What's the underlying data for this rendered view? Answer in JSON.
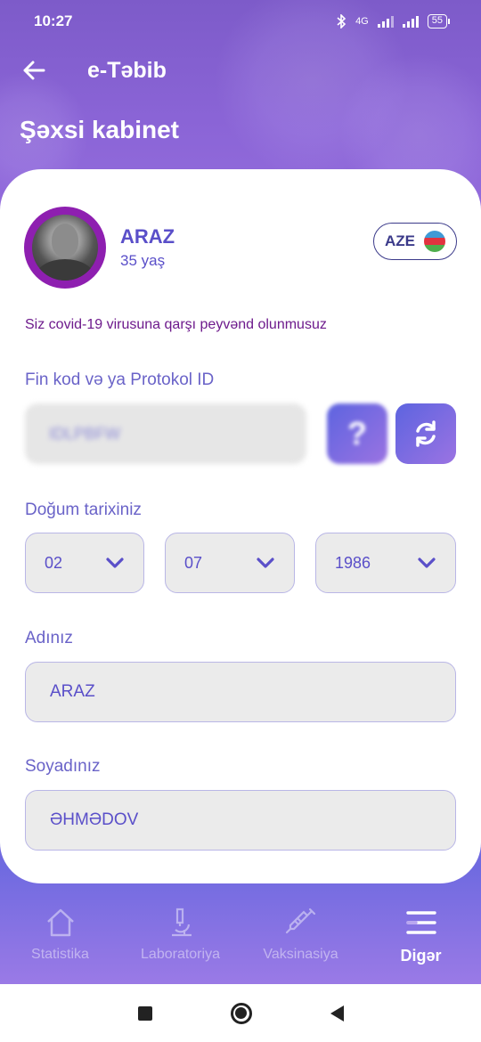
{
  "status_bar": {
    "time": "10:27",
    "network": "4G",
    "battery": "55"
  },
  "header": {
    "app_title": "e-Təbib",
    "page_title": "Şəxsi kabinet"
  },
  "profile": {
    "name": "ARAZ",
    "age": "35 yaş",
    "language": "AZE"
  },
  "vaccine_message": "Siz covid-19 virusuna qarşı peyvənd olunmusuz",
  "fin": {
    "label": "Fin kod və ya Protokol ID",
    "value": "IDLPBFW",
    "help_label": "?"
  },
  "birth_date": {
    "label": "Doğum tarixiniz",
    "day": "02",
    "month": "07",
    "year": "1986"
  },
  "first_name": {
    "label": "Adınız",
    "value": "ARAZ"
  },
  "last_name": {
    "label": "Soyadınız",
    "value": "ƏHMƏDOV"
  },
  "bottom_nav": {
    "items": [
      {
        "label": "Statistika",
        "icon": "home-icon"
      },
      {
        "label": "Laboratoriya",
        "icon": "microscope-icon"
      },
      {
        "label": "Vaksinasiya",
        "icon": "syringe-icon"
      },
      {
        "label": "Digər",
        "icon": "menu-icon"
      }
    ],
    "active": "Digər"
  },
  "colors": {
    "primary": "#5a4fc9",
    "header_gradient_top": "#7d5bc9",
    "accent_purple": "#8e1fb0",
    "field_bg": "#ebebeb"
  }
}
